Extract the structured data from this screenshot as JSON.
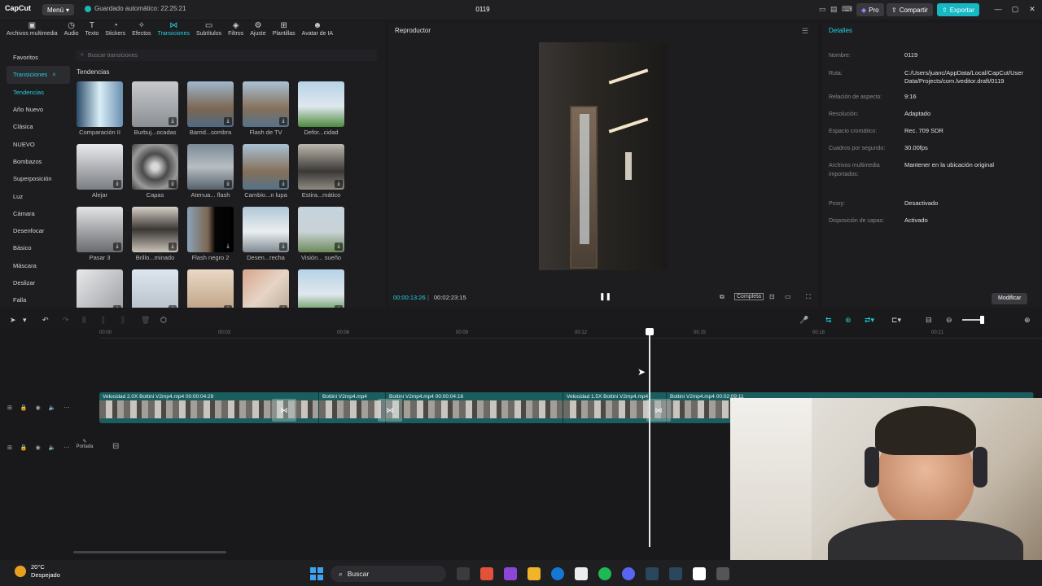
{
  "app": {
    "logo": "CapCut",
    "menu_label": "Menú",
    "autosave": "Guardado automático: 22:25:21",
    "project_title": "0119",
    "pro_label": "Pro",
    "share_label": "Compartir",
    "export_label": "Exportar"
  },
  "media_tabs": [
    {
      "label": "Archivos multimedia",
      "icon": "media-icon"
    },
    {
      "label": "Audio",
      "icon": "audio-icon"
    },
    {
      "label": "Texto",
      "icon": "text-icon"
    },
    {
      "label": "Stickers",
      "icon": "sticker-icon"
    },
    {
      "label": "Efectos",
      "icon": "effects-icon"
    },
    {
      "label": "Transiciones",
      "icon": "transitions-icon",
      "active": true
    },
    {
      "label": "Subtítulos",
      "icon": "subtitles-icon"
    },
    {
      "label": "Filtros",
      "icon": "filters-icon"
    },
    {
      "label": "Ajuste",
      "icon": "adjust-icon"
    },
    {
      "label": "Plantillas",
      "icon": "templates-icon"
    },
    {
      "label": "Avatar de IA",
      "icon": "avatar-icon"
    }
  ],
  "categories": [
    {
      "label": "Favoritos"
    },
    {
      "label": "Transiciones",
      "selected": true
    },
    {
      "label": "Tendencias",
      "accent": true
    },
    {
      "label": "Año Nuevo"
    },
    {
      "label": "Clásica"
    },
    {
      "label": "NUEVO"
    },
    {
      "label": "Bombazos"
    },
    {
      "label": "Superposición"
    },
    {
      "label": "Luz"
    },
    {
      "label": "Cámara"
    },
    {
      "label": "Desenfocar"
    },
    {
      "label": "Básico"
    },
    {
      "label": "Máscara"
    },
    {
      "label": "Deslizar"
    },
    {
      "label": "Falla"
    }
  ],
  "search_placeholder": "Buscar transiciones",
  "section_title": "Tendencias",
  "tiles": [
    {
      "label": "Comparación II",
      "bg": "linear-gradient(90deg,#2b4d6b,#d9eef7 50%,#6a8fb0)"
    },
    {
      "label": "Burbuj...ocadas",
      "bg": "linear-gradient(180deg,#c7c9cc,#8b8f94)"
    },
    {
      "label": "Barrid...sombra",
      "bg": "linear-gradient(180deg,#9fb7cc,#7b6651 60%,#4f6b84)"
    },
    {
      "label": "Flash de TV",
      "bg": "linear-gradient(180deg,#a9c1d4,#85705a 60%,#557289)"
    },
    {
      "label": "Defor...cidad",
      "bg": "linear-gradient(180deg,#b6d3e6,#dfe7ee 55%,#4c8a3e)"
    },
    {
      "label": "Alejar",
      "bg": "linear-gradient(180deg,#e8eaed,#7a7d82)"
    },
    {
      "label": "Capas",
      "bg": "radial-gradient(circle,#d9d9d9 10%,#4a4a4a 40%,#9a9a9a 70%,#3c3c3c)"
    },
    {
      "label": "Atenua... flash",
      "bg": "linear-gradient(180deg,#7b8a96,#b8bec3 50%,#56626c)"
    },
    {
      "label": "Cambio...n lupa",
      "bg": "linear-gradient(180deg,#a9c1d4,#85705a 60%,#557289)"
    },
    {
      "label": "Estira...mático",
      "bg": "linear-gradient(180deg,#bcb7ae,#3b3936 60%,#8e8a83)"
    },
    {
      "label": "Pasar 3",
      "bg": "linear-gradient(180deg,#e3e4e6,#696b6e)"
    },
    {
      "label": "Brillo...minado",
      "bg": "linear-gradient(180deg,#d7d0c7,#3a3633 50%,#c9c2b8)"
    },
    {
      "label": "Flash negro 2",
      "bg": "linear-gradient(90deg,#8aa4ba 0%,#7c6450 45%,#050505 60%,#000)"
    },
    {
      "label": "Desen...recha",
      "bg": "linear-gradient(180deg,#b1c7d6,#eaeef1 55%,#7f8a91)"
    },
    {
      "label": "Visión... sueño",
      "bg": "linear-gradient(180deg,#c4d4de,#c9d2d6 55%,#6c8a5b)"
    },
    {
      "label": "",
      "bg": "linear-gradient(135deg,#e8e9eb,#9a9ca0)"
    },
    {
      "label": "",
      "bg": "linear-gradient(180deg,#dde6ef,#b4bcc4)"
    },
    {
      "label": "",
      "bg": "linear-gradient(180deg,#ead9c7,#b99c7e)"
    },
    {
      "label": "",
      "bg": "linear-gradient(135deg,#d9a48d,#e6d5c6,#b8a695)"
    },
    {
      "label": "",
      "bg": "linear-gradient(180deg,#b6d3e6,#dfe7ee 55%,#4c8a3e)"
    }
  ],
  "player": {
    "title": "Reproductor",
    "time_current": "00:00:13:26",
    "time_total": "00:02:23:15",
    "complete_label": "Completa"
  },
  "details": {
    "title": "Detalles",
    "rows": [
      {
        "label": "Nombre:",
        "value": "0119"
      },
      {
        "label": "Ruta:",
        "value": "C:/Users/juanc/AppData/Local/CapCut/User Data/Projects/com.lveditor.draft/0119"
      },
      {
        "label": "Relación de aspecto:",
        "value": "9:16"
      },
      {
        "label": "Resolución:",
        "value": "Adaptado"
      },
      {
        "label": "Espacio cromático:",
        "value": "Rec. 709 SDR"
      },
      {
        "label": "Cuadros por segundo:",
        "value": "30.00fps"
      },
      {
        "label": "Archivos multimedia importados:",
        "value": "Mantener en la ubicación original"
      },
      {
        "label": "Proxy:",
        "value": "Desactivado"
      },
      {
        "label": "Disposición de capas:",
        "value": "Activado"
      }
    ],
    "modify_label": "Modificar"
  },
  "timeline": {
    "ticks": [
      "00:00",
      "00:03",
      "00:06",
      "00:09",
      "00:12",
      "00:15",
      "00:18",
      "00:21"
    ],
    "segments": [
      {
        "caption": "Velocidad 2.0X   Bottini V2mp4.mp4   00:00:04:29"
      },
      {
        "caption": "Bottini V2mp4.mp4"
      },
      {
        "caption": "Bottini V2mp4.mp4   00:00:04:16"
      },
      {
        "caption": "Velocidad 1.5X   Bottini V2mp4.mp4"
      },
      {
        "caption": "Bottini V2mp4.mp4   00:02:09:11"
      }
    ],
    "cover_label": "Portada"
  },
  "taskbar": {
    "temp": "20°C",
    "weather": "Despejado",
    "search_label": "Buscar"
  },
  "colors": {
    "accent": "#1fd2dc",
    "export": "#15b8c3",
    "track": "#1b5e5f"
  }
}
